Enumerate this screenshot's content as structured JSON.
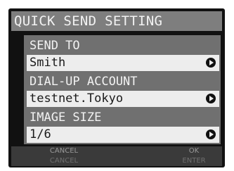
{
  "title": "QUICK SEND SETTING",
  "fields": [
    {
      "label": "SEND TO",
      "value": "Smith"
    },
    {
      "label": "DIAL-UP ACCOUNT",
      "value": "testnet.Tokyo"
    },
    {
      "label": "IMAGE SIZE",
      "value": "1/6"
    }
  ],
  "buttons": {
    "cancel": {
      "label": "CANCEL",
      "sublabel": "CANCEL"
    },
    "ok": {
      "label": "OK",
      "sublabel": "ENTER"
    }
  },
  "icons": {
    "select_arrow": "right-arrow-icon"
  }
}
